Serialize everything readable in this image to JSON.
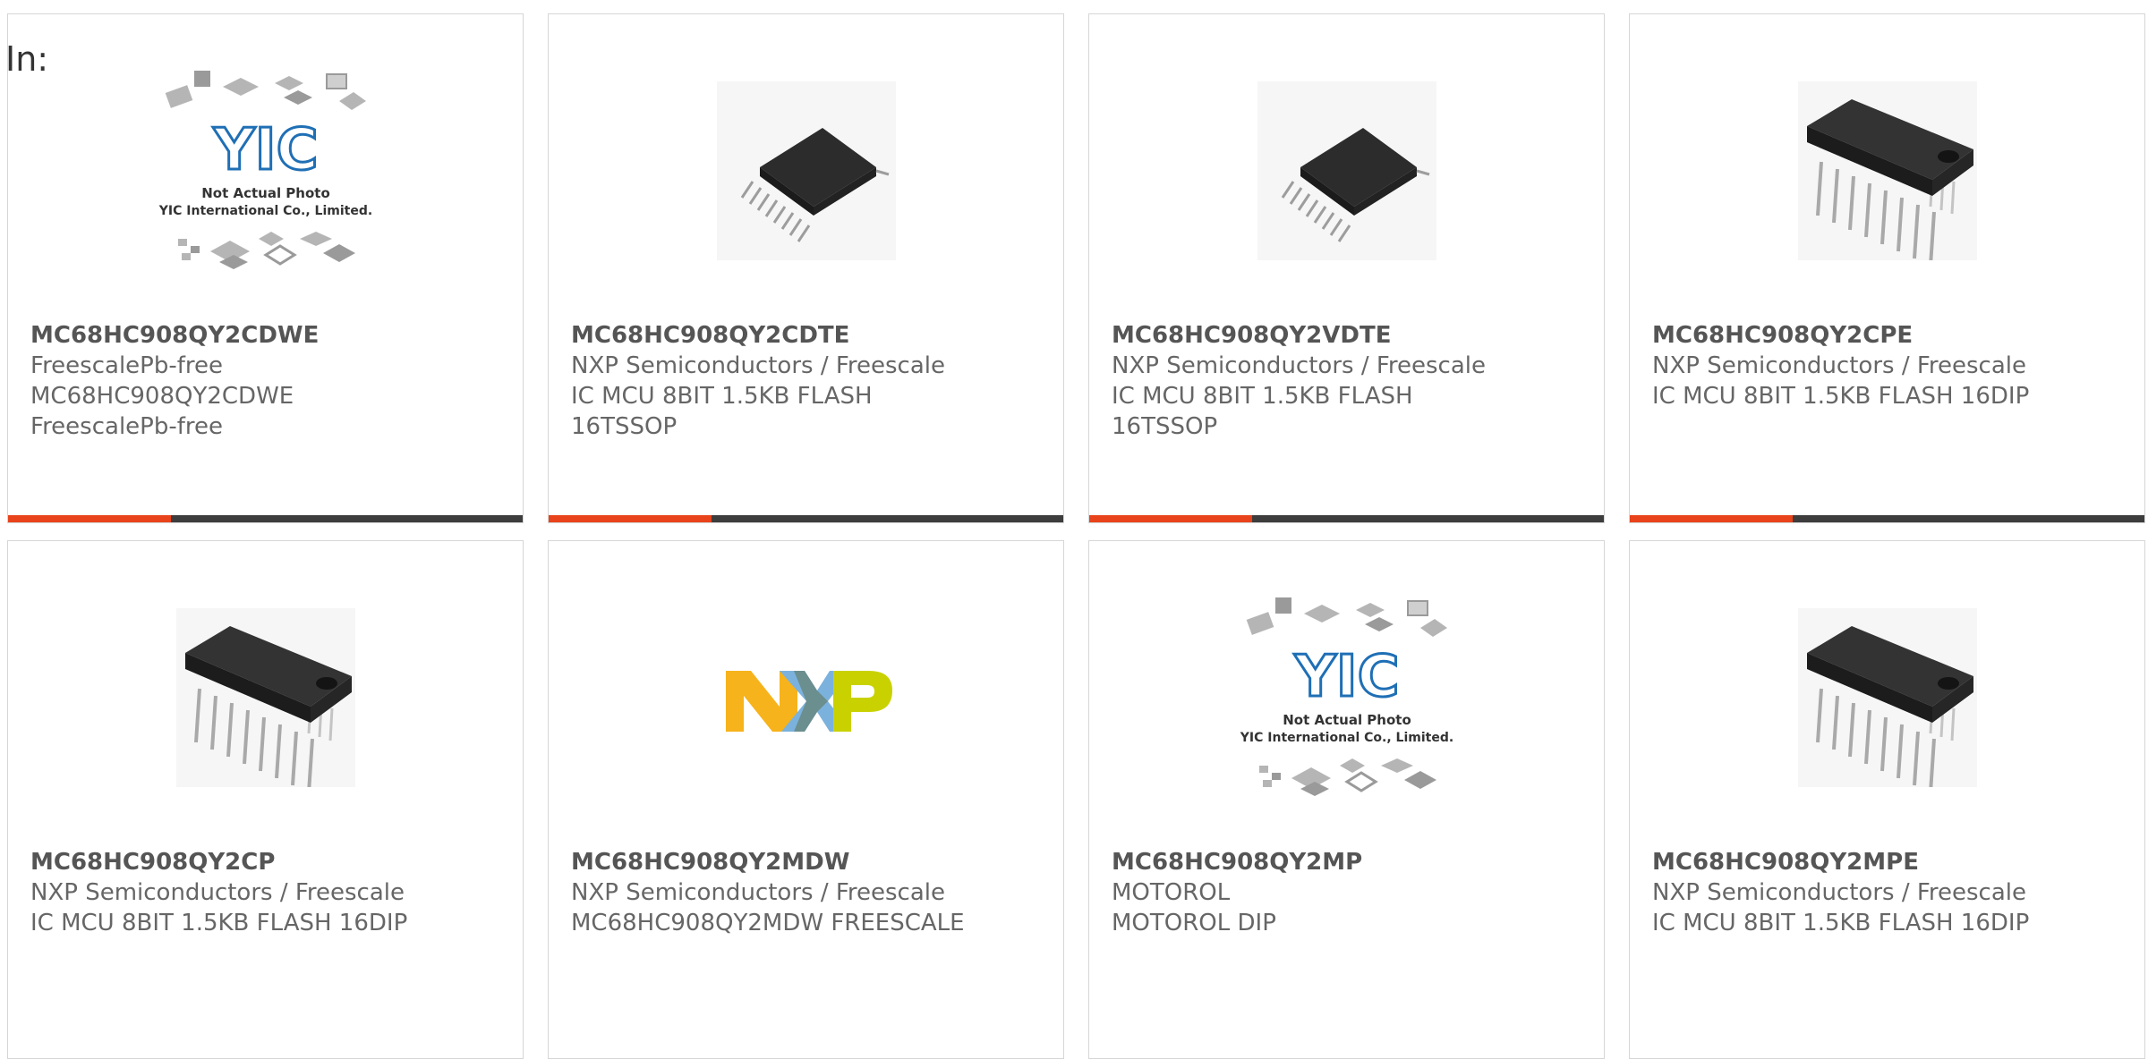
{
  "header": {
    "in_label": "In:"
  },
  "placeholder_image": {
    "text_line1": "Not Actual Photo",
    "text_line2": "YIC International Co., Limited.",
    "logo_text": "YIC"
  },
  "nxp_logo_text": "NXP",
  "colors": {
    "accent": "#e8431a",
    "bar_dark": "#3d3d3d",
    "card_border": "#d6d6d6",
    "text": "#666666",
    "part_number": "#555555",
    "yic_blue": "#1f6fb5"
  },
  "products": [
    {
      "part": "MC68HC908QY2CDWE",
      "lines": [
        "FreescalePb-free",
        "MC68HC908QY2CDWE",
        "FreescalePb-free"
      ],
      "image": "placeholder-photo",
      "highlight_bar": true
    },
    {
      "part": "MC68HC908QY2CDTE",
      "lines": [
        "NXP Semiconductors / Freescale",
        "IC MCU 8BIT 1.5KB FLASH",
        "16TSSOP"
      ],
      "image": "tssop-chip-icon",
      "highlight_bar": true
    },
    {
      "part": "MC68HC908QY2VDTE",
      "lines": [
        "NXP Semiconductors / Freescale",
        "IC MCU 8BIT 1.5KB FLASH",
        "16TSSOP"
      ],
      "image": "tssop-chip-icon",
      "highlight_bar": true
    },
    {
      "part": "MC68HC908QY2CPE",
      "lines": [
        "NXP Semiconductors / Freescale",
        "IC MCU 8BIT 1.5KB FLASH 16DIP"
      ],
      "image": "dip-chip-icon",
      "highlight_bar": true
    },
    {
      "part": "MC68HC908QY2CP",
      "lines": [
        "NXP Semiconductors / Freescale",
        "IC MCU 8BIT 1.5KB FLASH 16DIP"
      ],
      "image": "dip-chip-icon",
      "highlight_bar": false
    },
    {
      "part": "MC68HC908QY2MDW",
      "lines": [
        "NXP Semiconductors / Freescale",
        "MC68HC908QY2MDW FREESCALE"
      ],
      "image": "nxp-logo",
      "highlight_bar": false
    },
    {
      "part": "MC68HC908QY2MP",
      "lines": [
        "MOTOROL",
        "MOTOROL DIP"
      ],
      "image": "placeholder-photo",
      "highlight_bar": false
    },
    {
      "part": "MC68HC908QY2MPE",
      "lines": [
        "NXP Semiconductors / Freescale",
        "IC MCU 8BIT 1.5KB FLASH 16DIP"
      ],
      "image": "dip-chip-icon",
      "highlight_bar": false
    }
  ]
}
